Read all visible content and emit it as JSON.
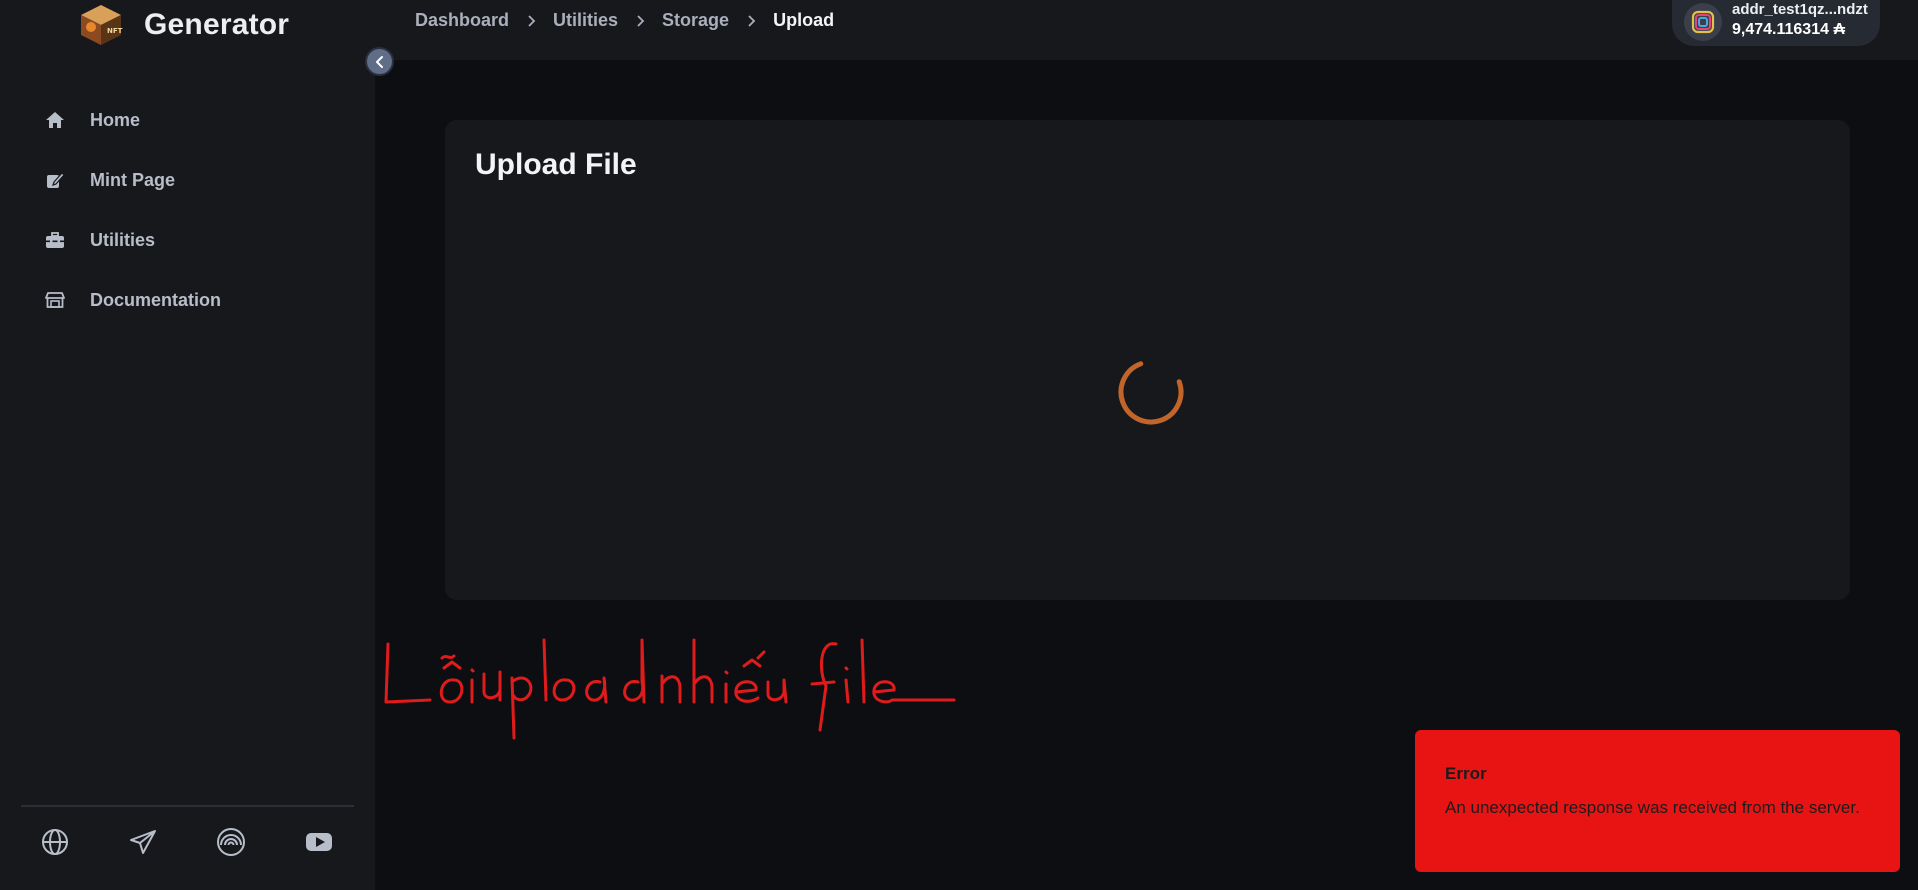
{
  "sidebar": {
    "brand": {
      "name": "Generator",
      "logo_icon": "nft-cube-logo"
    },
    "collapse_icon": "chevron-left-icon",
    "items": [
      {
        "label": "Home",
        "icon": "home-icon"
      },
      {
        "label": "Mint Page",
        "icon": "edit-icon"
      },
      {
        "label": "Utilities",
        "icon": "toolbox-icon"
      },
      {
        "label": "Documentation",
        "icon": "store-icon"
      }
    ],
    "social": [
      "globe-icon",
      "telegram-icon",
      "rainbow-icon",
      "youtube-icon"
    ]
  },
  "header": {
    "breadcrumb": [
      "Dashboard",
      "Utilities",
      "Storage",
      "Upload"
    ],
    "wallet": {
      "address": "addr_test1qz...ndzt",
      "balance": "9,474.116314 ₳",
      "icon": "eternl-wallet-icon"
    }
  },
  "main": {
    "card_title": "Upload File",
    "loading": true
  },
  "annotation": {
    "text": "Lỗi upload nhiều file",
    "color": "#e01b1b"
  },
  "toast": {
    "title": "Error",
    "message": "An unexpected response was received from the server.",
    "color": "#e81414"
  },
  "colors": {
    "background": "#0d0e11",
    "panel": "#17181c",
    "spinner": "#c2652a"
  }
}
